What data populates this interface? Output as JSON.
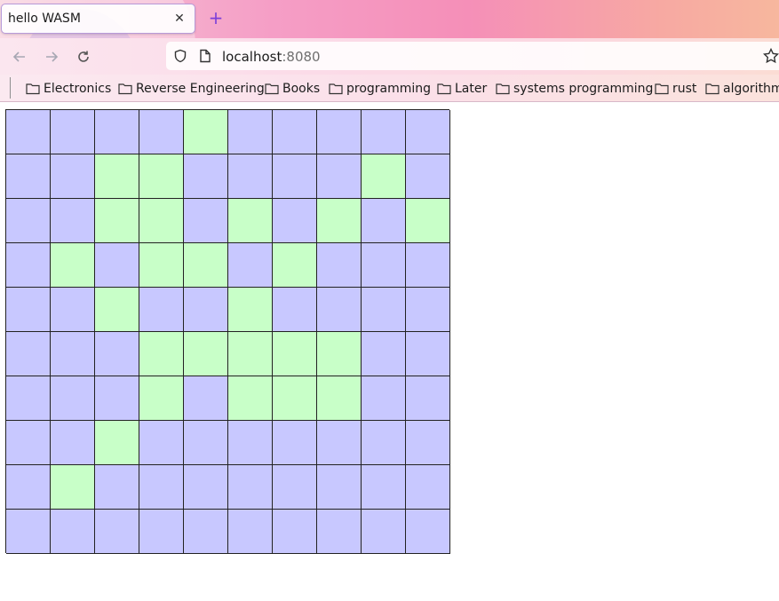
{
  "tab": {
    "title": "hello WASM",
    "close_icon": "close-icon",
    "new_tab_icon": "plus-icon"
  },
  "nav": {
    "url_host": "localhost",
    "url_port": ":8080",
    "icons": [
      "back-arrow-icon",
      "forward-arrow-icon",
      "reload-icon",
      "shield-icon",
      "page-icon",
      "star-icon"
    ]
  },
  "bookmarks": [
    "Electronics",
    "Reverse Engineering",
    "Books",
    "programming",
    "Later",
    "systems programming",
    "rust",
    "algorithm"
  ],
  "colors": {
    "cell_dead": "#c8c8ff",
    "cell_alive": "#c8ffc8",
    "grid_line": "#222222",
    "accent": "#7b3fd9"
  },
  "grid": {
    "rows": [
      [
        0,
        0,
        0,
        0,
        1,
        0,
        0,
        0,
        0,
        0
      ],
      [
        0,
        0,
        1,
        1,
        0,
        0,
        0,
        0,
        1,
        0
      ],
      [
        0,
        0,
        1,
        1,
        0,
        1,
        0,
        1,
        0,
        1
      ],
      [
        0,
        1,
        0,
        1,
        1,
        0,
        1,
        0,
        0,
        0
      ],
      [
        0,
        0,
        1,
        0,
        0,
        1,
        0,
        0,
        0,
        0
      ],
      [
        0,
        0,
        0,
        1,
        1,
        1,
        1,
        1,
        0,
        0
      ],
      [
        0,
        0,
        0,
        1,
        0,
        1,
        1,
        1,
        0,
        0
      ],
      [
        0,
        0,
        1,
        0,
        0,
        0,
        0,
        0,
        0,
        0
      ],
      [
        0,
        1,
        0,
        0,
        0,
        0,
        0,
        0,
        0,
        0
      ],
      [
        0,
        0,
        0,
        0,
        0,
        0,
        0,
        0,
        0,
        0
      ]
    ]
  }
}
